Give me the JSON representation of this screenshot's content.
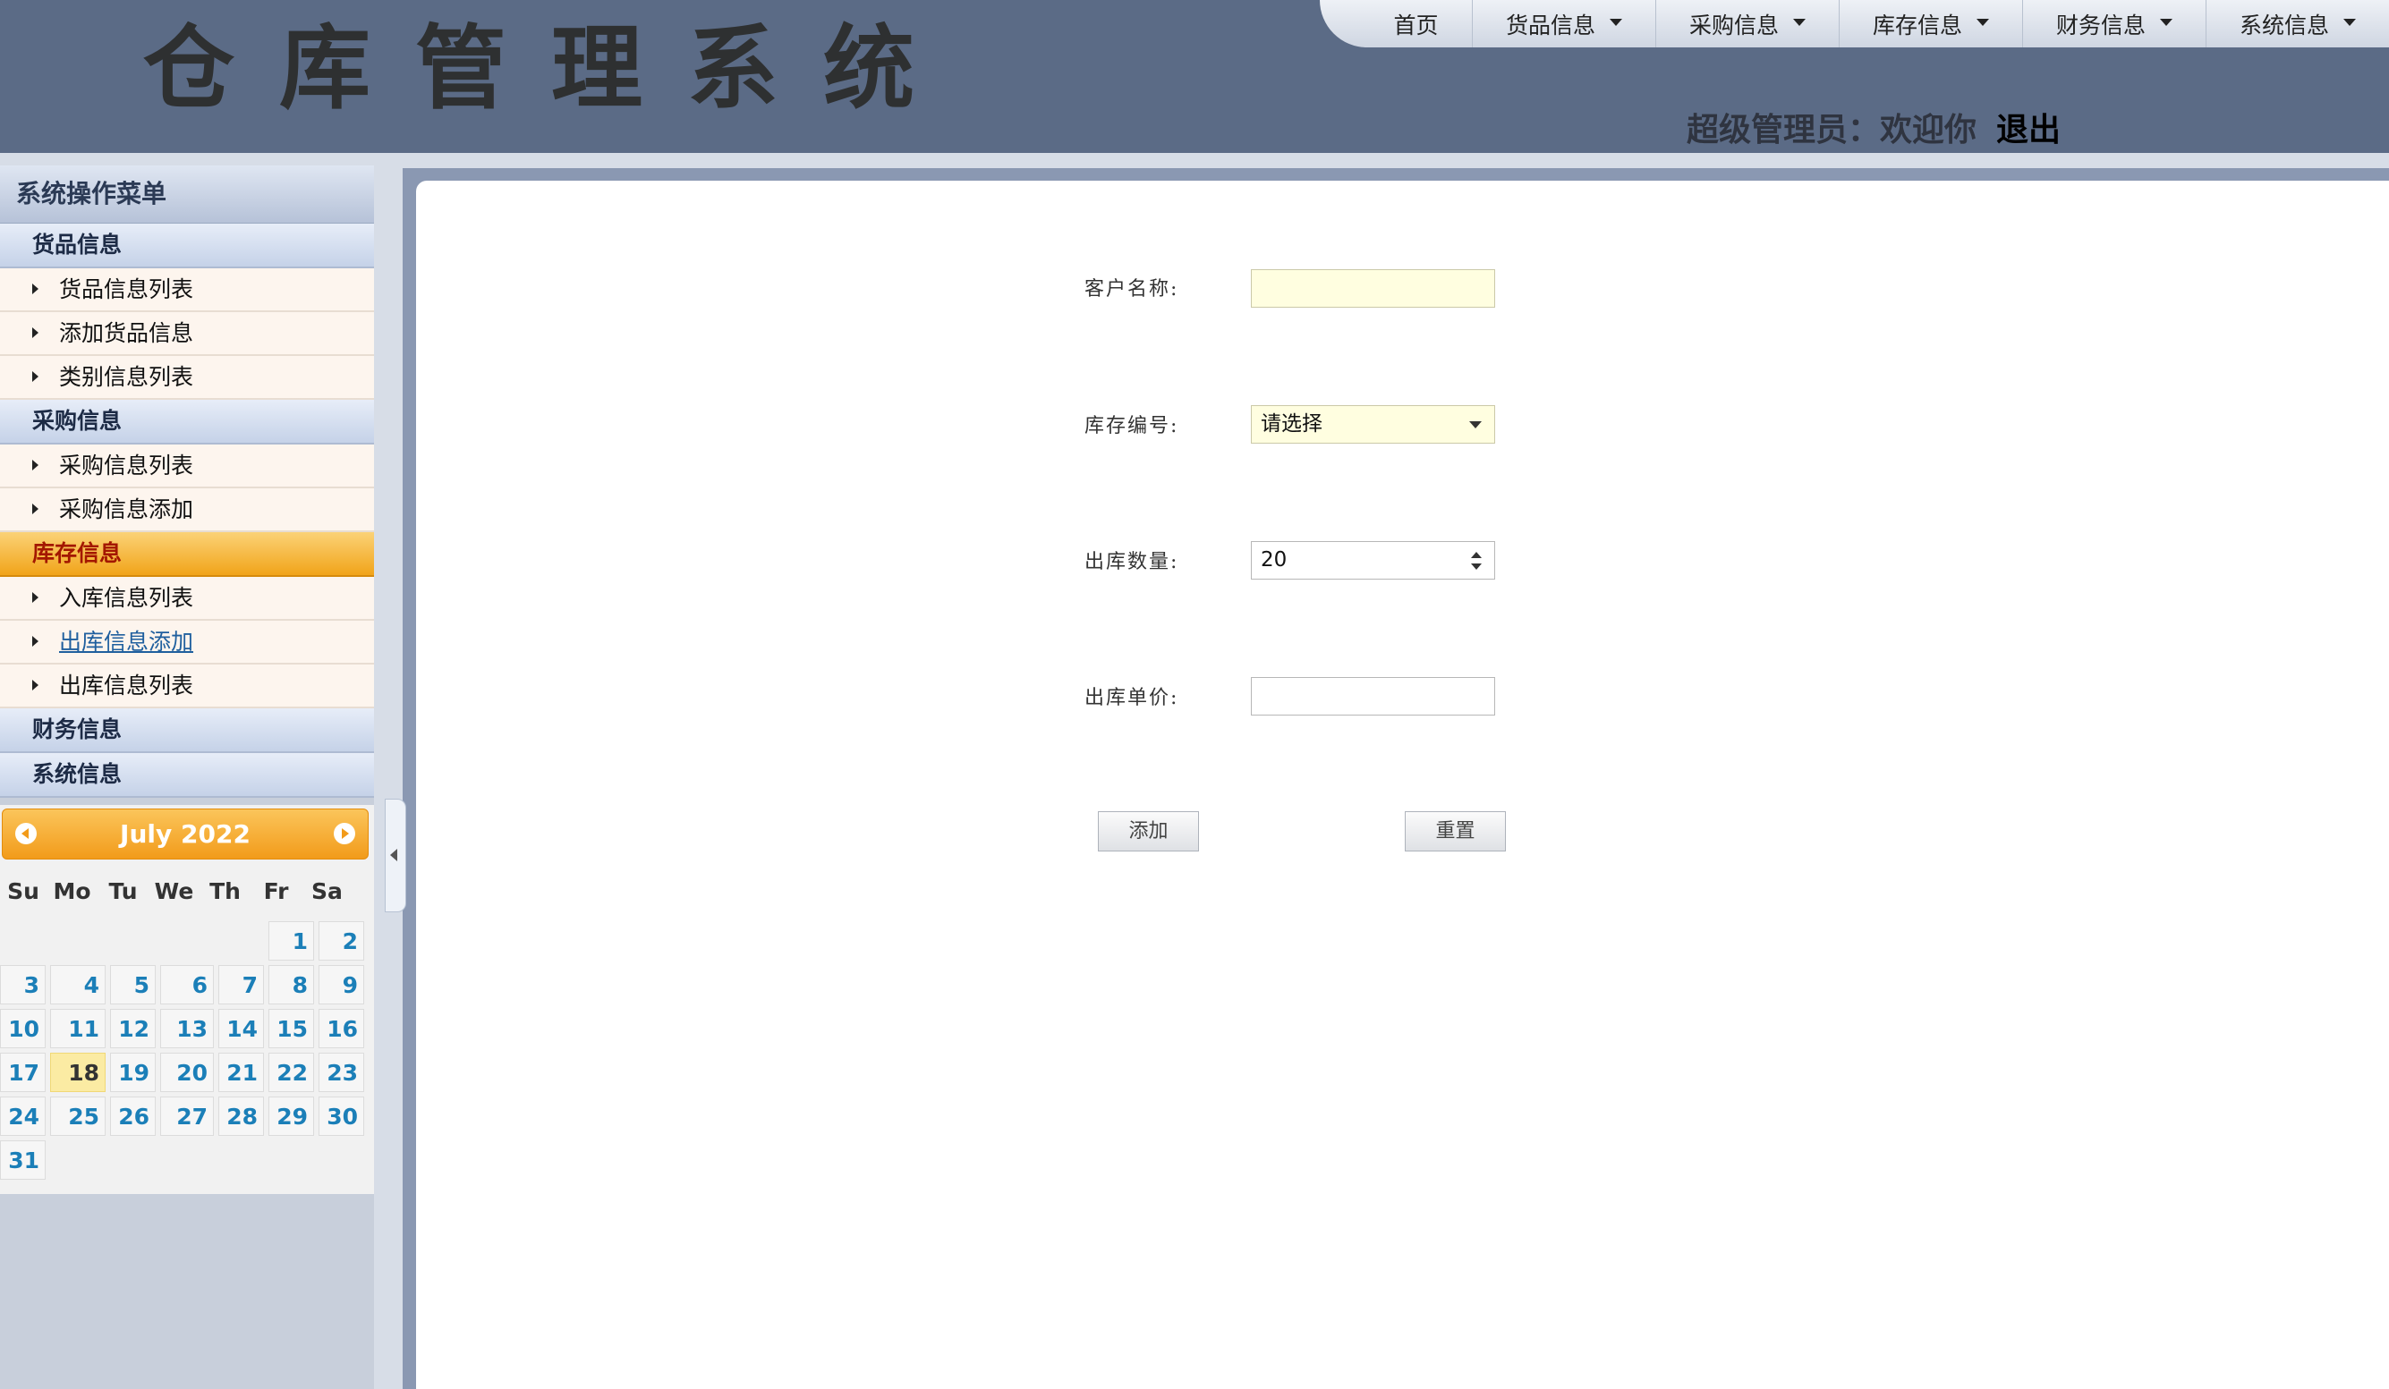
{
  "app": {
    "title": "仓库管理系统"
  },
  "topnav": {
    "items": [
      {
        "label": "首页",
        "dropdown": false
      },
      {
        "label": "货品信息",
        "dropdown": true
      },
      {
        "label": "采购信息",
        "dropdown": true
      },
      {
        "label": "库存信息",
        "dropdown": true
      },
      {
        "label": "财务信息",
        "dropdown": true
      },
      {
        "label": "系统信息",
        "dropdown": true
      }
    ]
  },
  "user": {
    "welcome": "超级管理员：欢迎你",
    "logout": "退出"
  },
  "sidebar": {
    "title": "系统操作菜单",
    "groups": [
      {
        "label": "货品信息",
        "items": [
          "货品信息列表",
          "添加货品信息",
          "类别信息列表"
        ]
      },
      {
        "label": "采购信息",
        "items": [
          "采购信息列表",
          "采购信息添加"
        ]
      },
      {
        "label": "库存信息",
        "active": true,
        "items": [
          "入库信息列表",
          "出库信息添加",
          "出库信息列表"
        ],
        "current": "出库信息添加"
      },
      {
        "label": "财务信息",
        "items": []
      },
      {
        "label": "系统信息",
        "items": []
      }
    ]
  },
  "calendar": {
    "title": "July 2022",
    "weekdays": [
      "Su",
      "Mo",
      "Tu",
      "We",
      "Th",
      "Fr",
      "Sa"
    ],
    "first_weekday": 5,
    "days": 31,
    "today": 18
  },
  "form": {
    "customer_name": {
      "label": "客户名称:",
      "value": ""
    },
    "stock_no": {
      "label": "库存编号:",
      "value": "请选择"
    },
    "out_quantity": {
      "label": "出库数量:",
      "value": "20"
    },
    "out_price": {
      "label": "出库单价:",
      "value": ""
    },
    "add_button": "添加",
    "reset_button": "重置"
  },
  "colors": {
    "header_bg": "#5b6b86",
    "active_group": "#f1a419",
    "link": "#1b7fb8"
  }
}
